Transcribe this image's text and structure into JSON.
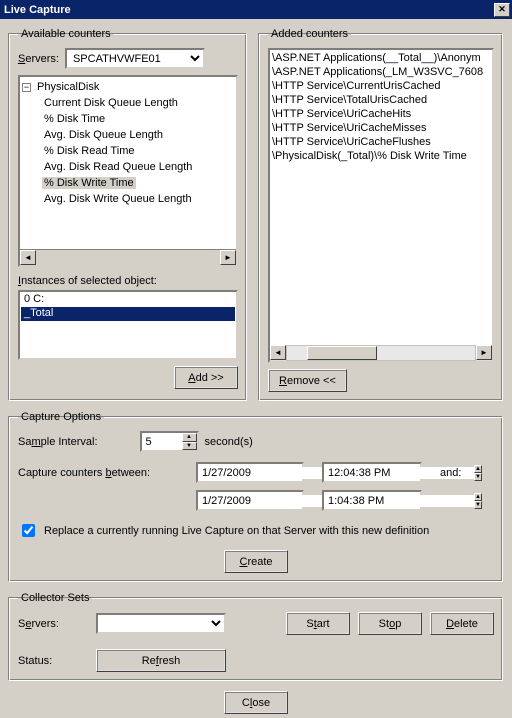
{
  "window": {
    "title": "Live Capture"
  },
  "available": {
    "legend": "Available counters",
    "servers_label": "Servers:",
    "server_selected": "SPCATHVWFE01",
    "tree_root": "PhysicalDisk",
    "tree_items": [
      "Current Disk Queue Length",
      "% Disk Time",
      "Avg. Disk Queue Length",
      "% Disk Read Time",
      "Avg. Disk Read Queue Length",
      "% Disk Write Time",
      "Avg. Disk Write Queue Length"
    ],
    "tree_selected_index": 5,
    "instances_label": "Instances of selected object:",
    "instances": [
      "0 C:",
      "_Total"
    ],
    "instances_selected_index": 1,
    "add_label": "Add >>"
  },
  "added": {
    "legend": "Added counters",
    "items": [
      "\\ASP.NET Applications(__Total__)\\Anonym",
      "\\ASP.NET Applications(_LM_W3SVC_7608",
      "\\HTTP Service\\CurrentUrisCached",
      "\\HTTP Service\\TotalUrisCached",
      "\\HTTP Service\\UriCacheHits",
      "\\HTTP Service\\UriCacheMisses",
      "\\HTTP Service\\UriCacheFlushes",
      "\\PhysicalDisk(_Total)\\% Disk Write Time"
    ],
    "remove_label": "Remove <<"
  },
  "capture": {
    "legend": "Capture Options",
    "sample_label": "Sample Interval:",
    "sample_value": "5",
    "sample_unit": "second(s)",
    "between_label": "Capture counters between:",
    "date1": "1/27/2009",
    "time1": "12:04:38 PM",
    "and_label": "and:",
    "date2": "1/27/2009",
    "time2": "1:04:38 PM",
    "replace_label": "Replace a currently running Live Capture on that Server with this new definition",
    "create_label": "Create"
  },
  "collector": {
    "legend": "Collector Sets",
    "servers_label": "Servers:",
    "server_value": "",
    "start_label": "Start",
    "stop_label": "Stop",
    "delete_label": "Delete",
    "status_label": "Status:",
    "refresh_label": "Refresh"
  },
  "footer": {
    "close_label": "Close"
  }
}
